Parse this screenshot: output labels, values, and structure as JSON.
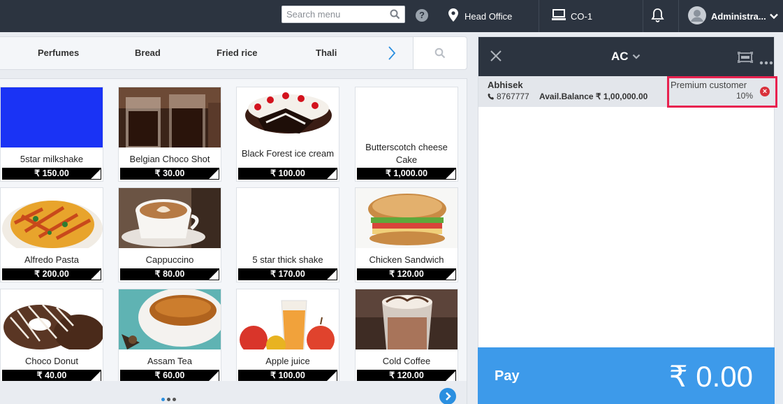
{
  "topbar": {
    "search_placeholder": "Search menu",
    "help_label": "?",
    "location": "Head Office",
    "counter": "CO-1",
    "user": "Administra..."
  },
  "categories": [
    "Perfumes",
    "Bread",
    "Fried rice",
    "Thali"
  ],
  "products": [
    {
      "name": "5star milkshake",
      "price": "₹ 150.00",
      "icon": "blue-placeholder"
    },
    {
      "name": "Belgian Choco Shot",
      "price": "₹ 30.00",
      "icon": "choco-shot-image"
    },
    {
      "name": "Black Forest ice cream",
      "price": "₹ 100.00",
      "icon": "black-forest-image"
    },
    {
      "name": "Butterscotch cheese Cake",
      "price": "₹ 1,000.00",
      "icon": "blank-image"
    },
    {
      "name": "Alfredo Pasta",
      "price": "₹ 200.00",
      "icon": "pasta-image"
    },
    {
      "name": "Cappuccino",
      "price": "₹ 80.00",
      "icon": "cappuccino-image"
    },
    {
      "name": "5 star thick shake",
      "price": "₹ 170.00",
      "icon": "blank-image"
    },
    {
      "name": "Chicken Sandwich",
      "price": "₹ 120.00",
      "icon": "sandwich-image"
    },
    {
      "name": "Choco Donut",
      "price": "₹ 40.00",
      "icon": "donut-image"
    },
    {
      "name": "Assam Tea",
      "price": "₹ 60.00",
      "icon": "tea-image"
    },
    {
      "name": "Apple juice",
      "price": "₹ 100.00",
      "icon": "juice-image"
    },
    {
      "name": "Cold Coffee",
      "price": "₹ 120.00",
      "icon": "cold-coffee-image"
    }
  ],
  "pager": {
    "pages": 3,
    "current": 1
  },
  "order": {
    "title": "AC",
    "customer": {
      "name": "Abhisek",
      "phone": "8767777",
      "balance": "Avail.Balance ₹ 1,00,000.00",
      "tier": "Premium customer",
      "discount": "10%"
    },
    "pay_label": "Pay",
    "total": "₹ 0.00"
  },
  "colors": {
    "topbar_bg": "#2c3440",
    "accent": "#3d9aea",
    "highlight_border": "#e8214f",
    "milkshake_tile": "#1a33f5"
  }
}
